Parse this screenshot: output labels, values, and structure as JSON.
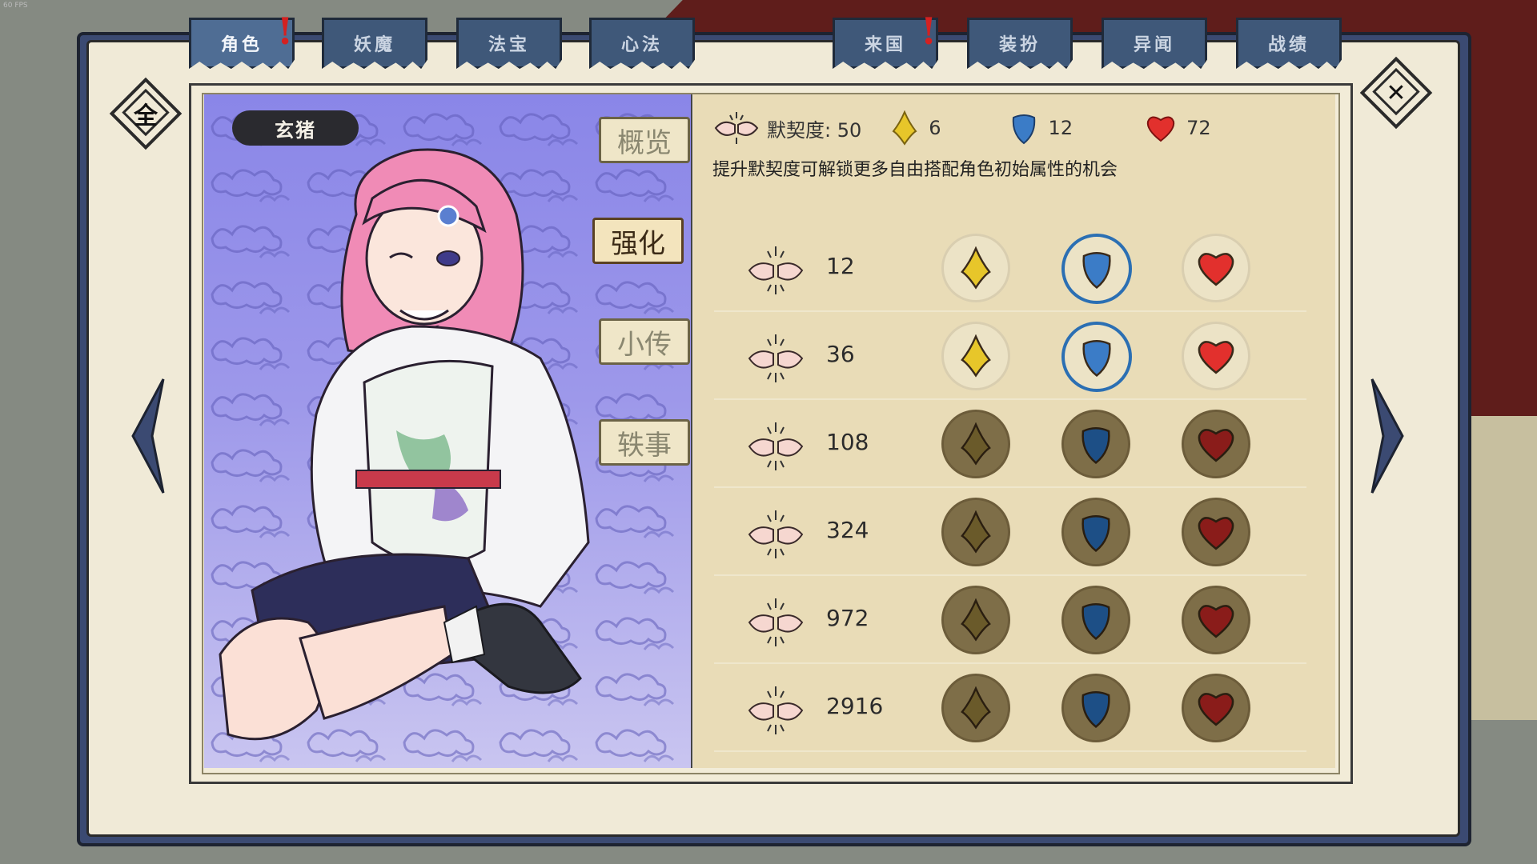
{
  "fps": "60 FPS",
  "tabs": [
    {
      "label": "角色",
      "active": true,
      "alert": true
    },
    {
      "label": "妖魔",
      "active": false,
      "alert": false
    },
    {
      "label": "法宝",
      "active": false,
      "alert": false
    },
    {
      "label": "心法",
      "active": false,
      "alert": false
    },
    {
      "label": "来国",
      "active": false,
      "alert": true
    },
    {
      "label": "装扮",
      "active": false,
      "alert": false
    },
    {
      "label": "异闻",
      "active": false,
      "alert": false
    },
    {
      "label": "战绩",
      "active": false,
      "alert": false
    }
  ],
  "alert_mark": "!",
  "all_button": "全",
  "close_button": "✕",
  "character": {
    "name": "玄猪"
  },
  "side_tabs": [
    {
      "label": "概览",
      "active": false
    },
    {
      "label": "强化",
      "active": true
    },
    {
      "label": "小传",
      "active": false
    },
    {
      "label": "轶事",
      "active": false
    }
  ],
  "stats": {
    "affinity_label": "默契度: 50",
    "attack": "6",
    "defense": "12",
    "health": "72"
  },
  "hint": "提升默契度可解锁更多自由搭配角色初始属性的机会",
  "rows": [
    {
      "threshold": "12",
      "unlocked": true,
      "selected": "defense"
    },
    {
      "threshold": "36",
      "unlocked": true,
      "selected": "defense"
    },
    {
      "threshold": "108",
      "unlocked": false,
      "selected": ""
    },
    {
      "threshold": "324",
      "unlocked": false,
      "selected": ""
    },
    {
      "threshold": "972",
      "unlocked": false,
      "selected": ""
    },
    {
      "threshold": "2916",
      "unlocked": false,
      "selected": ""
    }
  ],
  "colors": {
    "attack": "#e7c62a",
    "defense": "#3b7cc7",
    "health": "#e2302d",
    "locked_attack": "#6a5a2a",
    "locked_defense": "#1d4f86",
    "locked_health": "#8a1c1a"
  },
  "icons": {
    "attack": "flame-icon",
    "defense": "shield-icon",
    "health": "heart-icon",
    "affinity": "fist-bump-icon"
  }
}
